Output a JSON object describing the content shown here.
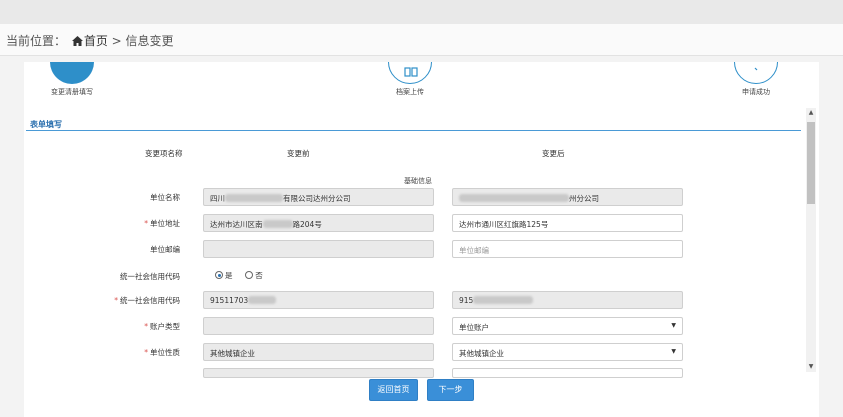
{
  "breadcrumb": {
    "prefix": "当前位置：",
    "home": "首页",
    "separator": " > ",
    "current": "信息变更"
  },
  "steps": [
    {
      "label": "变更清册填写",
      "state": "active"
    },
    {
      "label": "档案上传",
      "state": "pending"
    },
    {
      "label": "申请成功",
      "state": "pending"
    }
  ],
  "form": {
    "section_title": "表单填写",
    "columns": {
      "name": "变更项名称",
      "before": "变更前",
      "after": "变更后"
    },
    "group_label": "基础信息",
    "rows": [
      {
        "label": "单位名称",
        "required": false,
        "before": "四川",
        "before_tail": "有限公司达州分公司",
        "after": "",
        "after_tail": "州分公司",
        "after_gray": true
      },
      {
        "label": "单位地址",
        "required": true,
        "before": "达州市达川区南",
        "before_tail": "路204号",
        "after": "达州市通川区红旗路125号",
        "after_tail": "",
        "after_gray": false
      },
      {
        "label": "单位邮编",
        "required": false,
        "before": "",
        "before_tail": "",
        "after": "",
        "after_tail": "",
        "after_placeholder": "单位邮编",
        "after_gray": false
      },
      {
        "label": "统一社会信用代码",
        "required": true,
        "before": "91511703",
        "before_tail": "",
        "after": "915",
        "after_tail": "",
        "after_gray": true
      },
      {
        "label": "账户类型",
        "required": true,
        "before": "",
        "before_tail": "",
        "after": "单位账户",
        "after_tail": "",
        "after_gray": false,
        "select": true
      },
      {
        "label": "单位性质",
        "required": true,
        "before": "其他城镇企业",
        "before_tail": "",
        "after": "其他城镇企业",
        "after_tail": "",
        "after_gray": false,
        "select": true
      }
    ],
    "credit_code_question": {
      "label": "统一社会信用代码",
      "options": [
        "是",
        "否"
      ],
      "selected": "是"
    }
  },
  "buttons": {
    "back": "返回首页",
    "next": "下一步"
  },
  "colors": {
    "accent": "#2e8fc9",
    "button": "#3a8fd8",
    "required": "#d9534f"
  }
}
